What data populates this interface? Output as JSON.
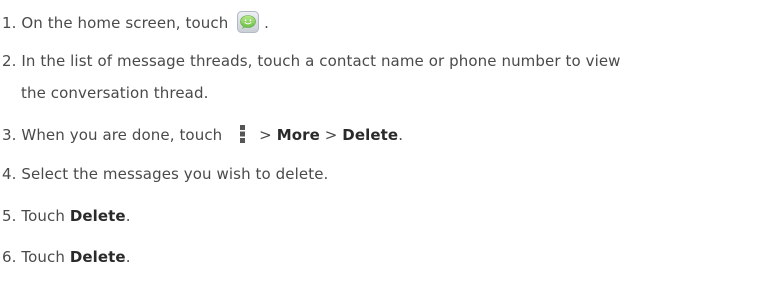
{
  "steps": [
    {
      "number": "1.",
      "text_before": " On the home screen, touch ",
      "icon": "messaging-app-icon",
      "text_after": " ."
    },
    {
      "number": "2.",
      "line1": " In the list of message threads, touch a contact name or phone number to view",
      "line2": "the conversation thread."
    },
    {
      "number": "3.",
      "text_before": " When you are done, touch ",
      "icon": "menu-icon",
      "sep1": "> ",
      "more": "More",
      "sep2": " > ",
      "delete": "Delete",
      "end": "."
    },
    {
      "number": "4.",
      "text": " Select the messages you wish to delete."
    },
    {
      "number": "5.",
      "text_before": " Touch ",
      "bold": "Delete",
      "end": "."
    },
    {
      "number": "6.",
      "text_before": " Touch ",
      "bold": "Delete",
      "end": "."
    }
  ],
  "colors": {
    "text": "#4a4a4a",
    "icon_bubble": "#8fd36b",
    "icon_bg": "#d9dde3",
    "menu_dots": "#555555"
  }
}
